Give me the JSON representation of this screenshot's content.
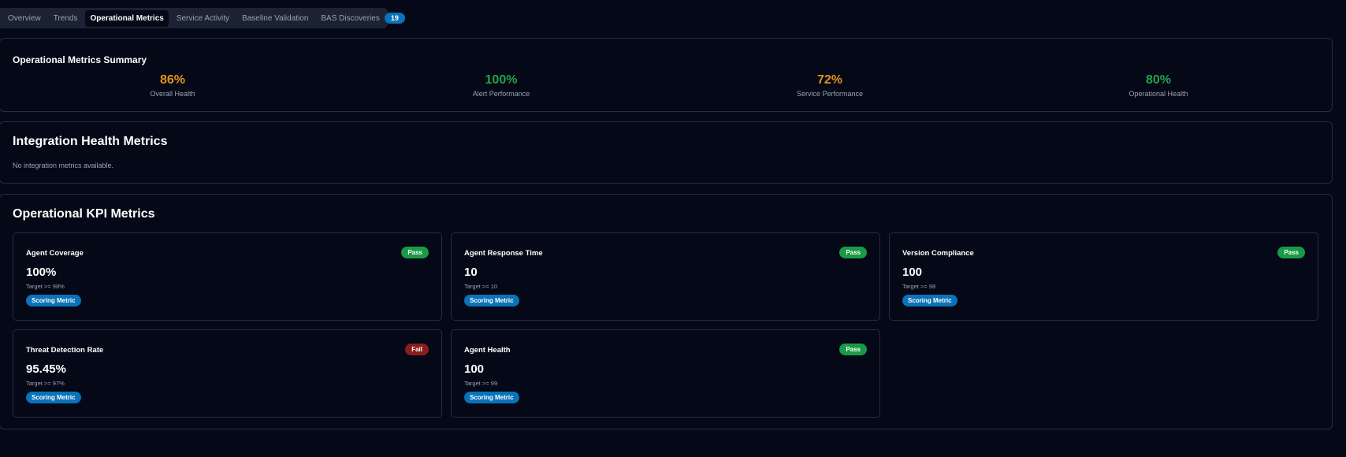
{
  "tabs": [
    {
      "label": "Overview",
      "active": false
    },
    {
      "label": "Trends",
      "active": false
    },
    {
      "label": "Operational Metrics",
      "active": true
    },
    {
      "label": "Service Activity",
      "active": false
    },
    {
      "label": "Baseline Validation",
      "active": false
    },
    {
      "label": "BAS Discoveries",
      "active": false,
      "count": "19"
    }
  ],
  "summary": {
    "title": "Operational Metrics Summary",
    "metrics": [
      {
        "value": "86%",
        "label": "Overall Health",
        "color": "#e3941a"
      },
      {
        "value": "100%",
        "label": "Alert Performance",
        "color": "#22a44a"
      },
      {
        "value": "72%",
        "label": "Service Performance",
        "color": "#e3941a"
      },
      {
        "value": "80%",
        "label": "Operational Health",
        "color": "#22a44a"
      }
    ]
  },
  "integration": {
    "title": "Integration Health Metrics",
    "empty_text": "No integration metrics available."
  },
  "kpi": {
    "title": "Operational KPI Metrics",
    "cards": [
      {
        "name": "Agent Coverage",
        "status": "Pass",
        "status_color": "#1a9a45",
        "value": "100%",
        "target": "Target >= 98%",
        "tag": "Scoring Metric"
      },
      {
        "name": "Agent Response Time",
        "status": "Pass",
        "status_color": "#1a9a45",
        "value": "10",
        "target": "Target >= 10",
        "tag": "Scoring Metric"
      },
      {
        "name": "Version Compliance",
        "status": "Pass",
        "status_color": "#1a9a45",
        "value": "100",
        "target": "Target >= 98",
        "tag": "Scoring Metric"
      },
      {
        "name": "Threat Detection Rate",
        "status": "Fail",
        "status_color": "#8b1c1c",
        "value": "95.45%",
        "target": "Target >= 97%",
        "tag": "Scoring Metric"
      },
      {
        "name": "Agent Health",
        "status": "Pass",
        "status_color": "#1a9a45",
        "value": "100",
        "target": "Target >= 99",
        "tag": "Scoring Metric"
      }
    ]
  }
}
